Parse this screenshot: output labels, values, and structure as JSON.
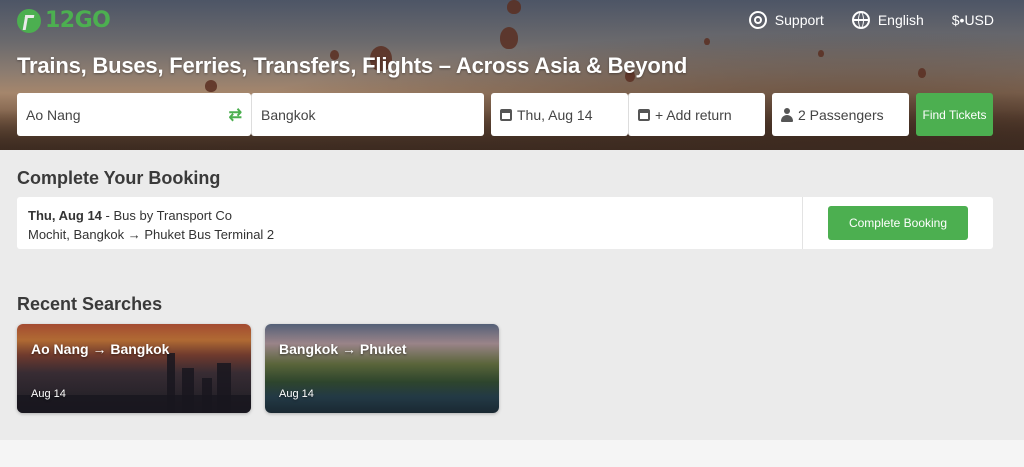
{
  "brand": {
    "logo_text": "12GO",
    "color": "#4caf50"
  },
  "topnav": {
    "support": "Support",
    "language": "English",
    "currency": "$•USD"
  },
  "headline": "Trains, Buses, Ferries, Transfers, Flights – Across Asia & Beyond",
  "search": {
    "from": "Ao Nang",
    "to": "Bangkok",
    "date": "Thu, Aug 14",
    "return": "+ Add return",
    "passengers": "2 Passengers",
    "submit": "Find Tickets"
  },
  "booking": {
    "title": "Complete Your Booking",
    "date": "Thu, Aug 14",
    "detail": " - Bus by Transport Co",
    "route": "Mochit, Bangkok → Phuket Bus Terminal 2",
    "button": "Complete Booking"
  },
  "recent": {
    "title": "Recent Searches",
    "items": [
      {
        "route": "Ao Nang → Bangkok",
        "date": "Aug 14"
      },
      {
        "route": "Bangkok → Phuket",
        "date": "Aug 14"
      }
    ]
  }
}
